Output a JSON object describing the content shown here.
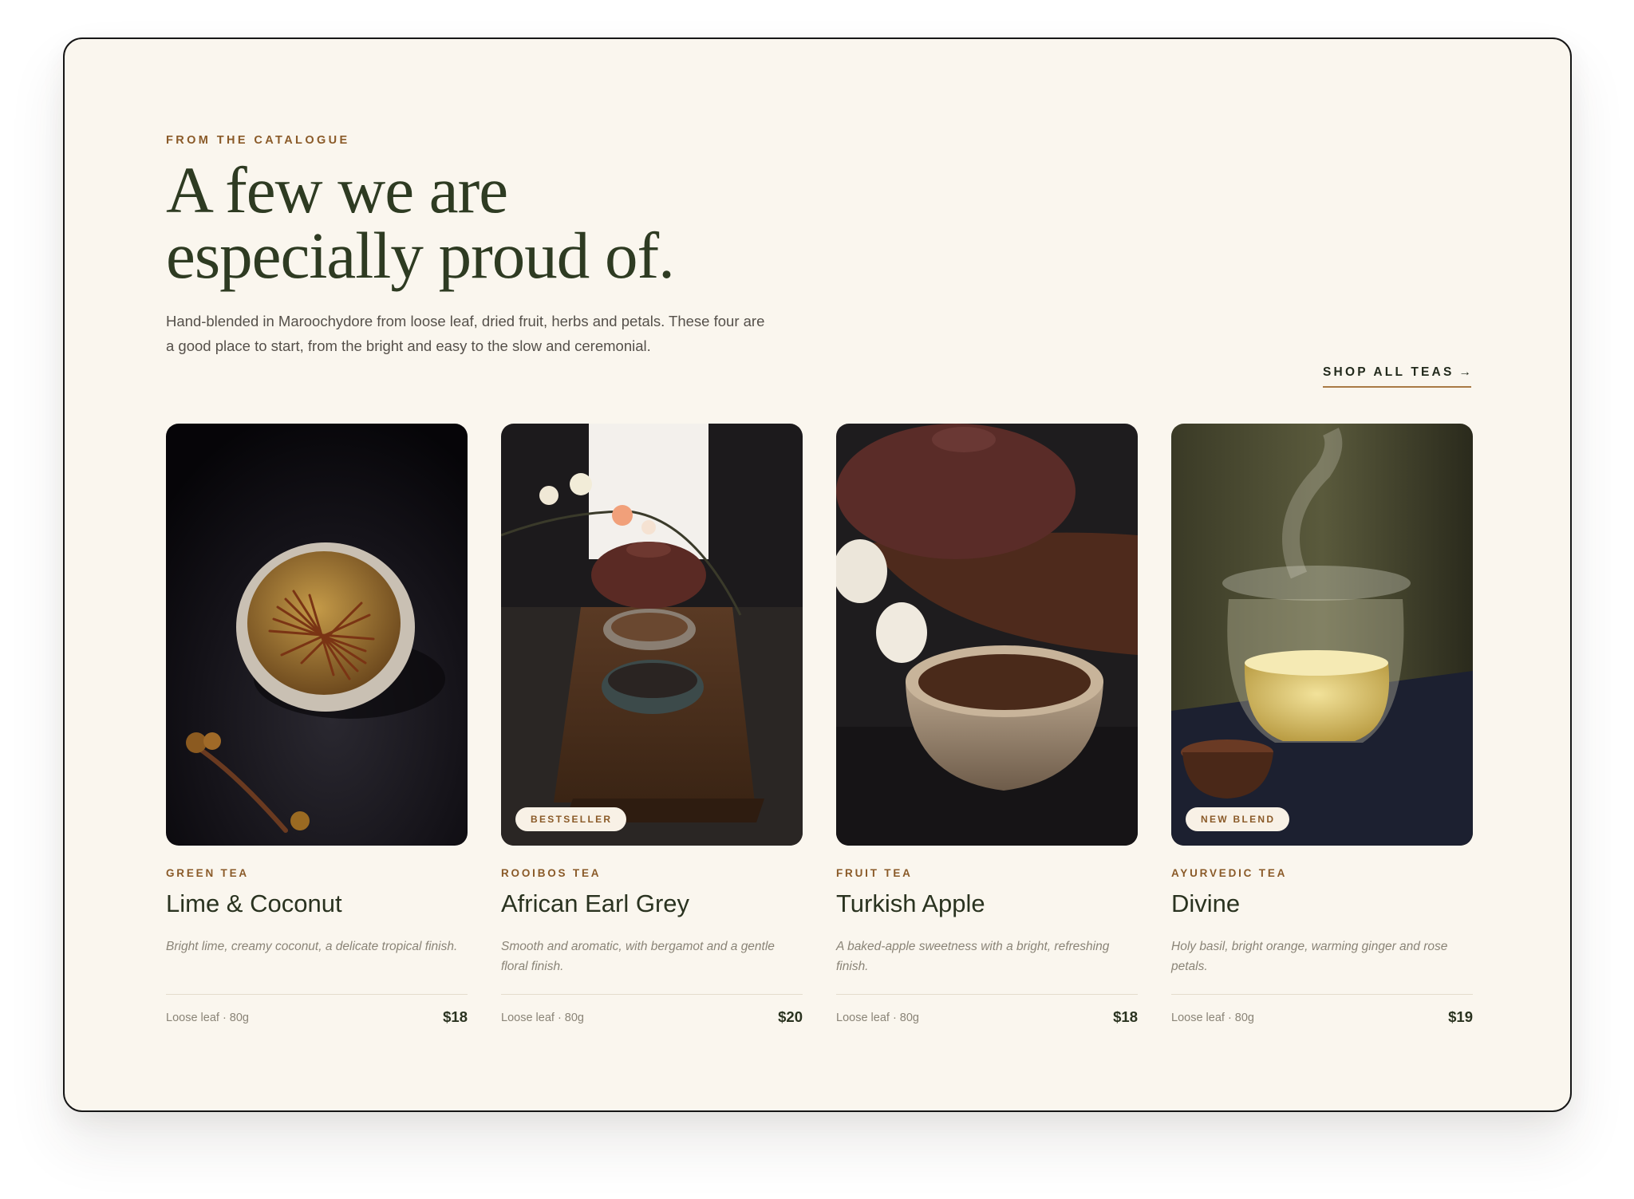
{
  "section": {
    "eyebrow": "FROM THE CATALOGUE",
    "headline_line1": "A few we are",
    "headline_line2": "especially proud of.",
    "intro_line1": "Hand-blended in Maroochydore from loose leaf, dried fruit, herbs and petals. These four are",
    "intro_line2": "a good place to start, from the bright and easy to the slow and ceremonial.",
    "shop_all_label": "SHOP ALL TEAS",
    "shop_all_arrow": "→"
  },
  "products": [
    {
      "category": "GREEN TEA",
      "name": "Lime & Coconut",
      "description": "Bright lime, creamy coconut, a delicate tropical finish.",
      "meta": "Loose leaf · 80g",
      "price": "$18",
      "badge": "",
      "image": "white cup of loose green tea with dried buds on dark surface"
    },
    {
      "category": "ROOIBOS TEA",
      "name": "African Earl Grey",
      "description": "Smooth and aromatic, with bergamot and a gentle floral finish.",
      "meta": "Loose leaf · 80g",
      "price": "$20",
      "badge": "BESTSELLER",
      "image": "clay teapot and tea bowls on a wooden tray with blossom branch"
    },
    {
      "category": "FRUIT TEA",
      "name": "Turkish Apple",
      "description": "A baked-apple sweetness with a bright, refreshing finish.",
      "meta": "Loose leaf · 80g",
      "price": "$18",
      "badge": "",
      "image": "stoneware bowl of tea in front of a red clay teapot and white flowers"
    },
    {
      "category": "AYURVEDIC TEA",
      "name": "Divine",
      "description": "Holy basil, bright orange, warming ginger and rose petals.",
      "meta": "Loose leaf · 80g",
      "price": "$19",
      "badge": "NEW BLEND",
      "image": "steaming glass pitcher of golden tea beside a small clay cup"
    }
  ]
}
